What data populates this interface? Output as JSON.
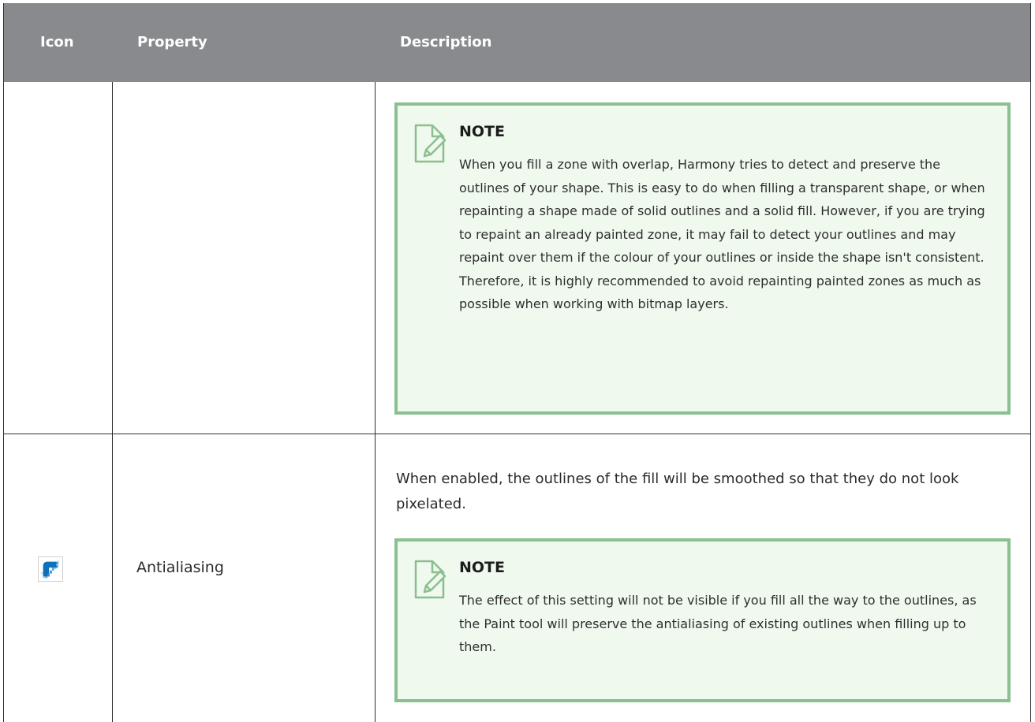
{
  "header": {
    "icon": "Icon",
    "property": "Property",
    "description": "Description"
  },
  "rows": [
    {
      "icon": "",
      "property": "",
      "description": "",
      "note": {
        "icon": "note-pencil-icon",
        "title": "NOTE",
        "body": "When you fill a zone with overlap, Harmony tries to detect and preserve the outlines of your shape. This is easy to do when filling a transparent shape, or when repainting a shape made of solid outlines and a solid fill. However, if you are trying to repaint an already painted zone, it may fail to detect your outlines and may repaint over them if the colour of your outlines or inside the shape isn't consistent. Therefore, it is highly recommended to avoid repainting painted zones as much as possible when working with bitmap layers."
      }
    },
    {
      "icon": "antialiasing-icon",
      "property": "Antialiasing",
      "description": "When enabled, the outlines of the fill will be smoothed so that they do not look pixelated.",
      "note": {
        "icon": "note-pencil-icon",
        "title": "NOTE",
        "body": "The effect of this setting will not be visible if you fill all the way to the outlines, as the Paint tool will preserve the antialiasing of existing outlines when filling up to them."
      }
    }
  ],
  "colors": {
    "header_bg": "#898a8e",
    "header_text": "#ffffff",
    "note_bg": "#eff9ee",
    "note_border": "#8cbf8f",
    "icon_blue": "#0f6fb8"
  }
}
